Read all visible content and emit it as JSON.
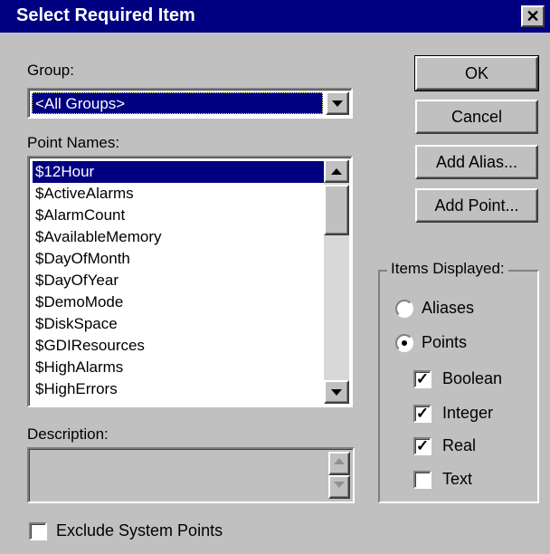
{
  "window": {
    "title": "Select Required Item",
    "close_label": "✕"
  },
  "group": {
    "label": "Group:",
    "selected": "<All Groups>"
  },
  "point_names": {
    "label": "Point Names:",
    "items": [
      "$12Hour",
      "$ActiveAlarms",
      "$AlarmCount",
      "$AvailableMemory",
      "$DayOfMonth",
      "$DayOfYear",
      "$DemoMode",
      "$DiskSpace",
      "$GDIResources",
      "$HighAlarms",
      "$HighErrors"
    ],
    "selected_index": 0
  },
  "description": {
    "label": "Description:",
    "value": ""
  },
  "exclude_system_points": {
    "label": "Exclude System Points",
    "checked": false
  },
  "buttons": {
    "ok": "OK",
    "cancel": "Cancel",
    "add_alias": "Add Alias...",
    "add_point": "Add Point..."
  },
  "items_displayed": {
    "label": "Items Displayed:",
    "radios": [
      {
        "label": "Aliases",
        "selected": false
      },
      {
        "label": "Points",
        "selected": true
      }
    ],
    "checkboxes": [
      {
        "label": "Boolean",
        "checked": true
      },
      {
        "label": "Integer",
        "checked": true
      },
      {
        "label": "Real",
        "checked": true
      },
      {
        "label": "Text",
        "checked": false
      }
    ]
  },
  "colors": {
    "titlebar": "#000080",
    "face": "#c0c0c0",
    "selection": "#000080"
  }
}
